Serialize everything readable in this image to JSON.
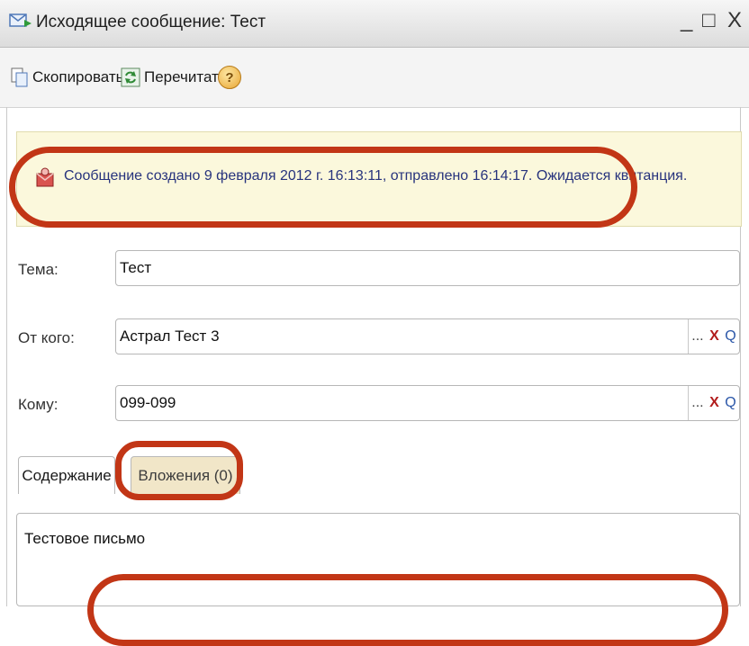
{
  "window": {
    "title": "Исходящее сообщение: Тест",
    "minimize_glyph": "_",
    "maximize_glyph": "□",
    "close_glyph": "X"
  },
  "toolbar": {
    "copy_label": "Скопировать",
    "reread_label": "Перечитать",
    "help_glyph": "?"
  },
  "info": {
    "message": "Сообщение создано 9 февраля 2012 г. 16:13:11, отправлено 16:14:17. Ожидается квитанция."
  },
  "form": {
    "subject_label": "Тема:",
    "subject_value": "Тест",
    "from_label": "От кого:",
    "from_value": "Астрал Тест 3",
    "to_label": "Кому:",
    "to_value": "099-099"
  },
  "field_buttons": {
    "dots": "...",
    "clear": "X",
    "search": "Q"
  },
  "tabs": [
    {
      "label": "Содержание",
      "active": true
    },
    {
      "label": "Вложения (0)",
      "active": false
    }
  ],
  "content": {
    "body": "Тестовое письмо"
  },
  "colors": {
    "highlight": "#c23616",
    "info_bg": "#fbf8dc",
    "info_text": "#27337d",
    "attach_tab_bg": "#f1e6c8"
  }
}
